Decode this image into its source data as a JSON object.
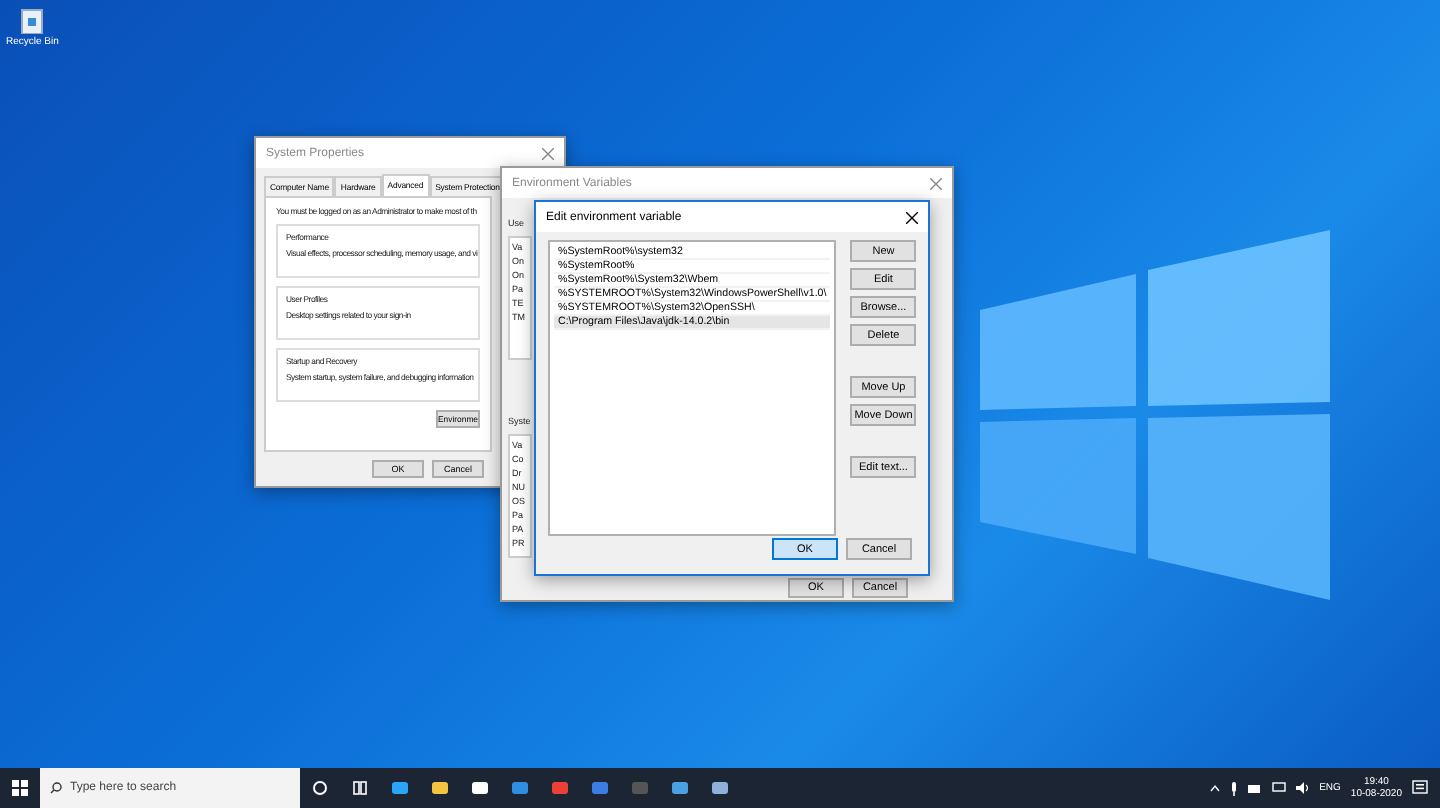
{
  "desktop_icons": [
    {
      "label": "Recycle Bin"
    }
  ],
  "system_properties": {
    "title": "System Properties",
    "tabs": [
      {
        "label": "Computer Name",
        "selected": false
      },
      {
        "label": "Hardware",
        "selected": false
      },
      {
        "label": "Advanced",
        "selected": true
      },
      {
        "label": "System Protection",
        "selected": false
      }
    ],
    "notice": "You must be logged on as an Administrator to make most of th",
    "groups": [
      {
        "title": "Performance",
        "description": "Visual effects, processor scheduling, memory usage, and vi"
      },
      {
        "title": "User Profiles",
        "description": "Desktop settings related to your sign-in"
      },
      {
        "title": "Startup and Recovery",
        "description": "System startup, system failure, and debugging information"
      }
    ],
    "environment_button": "Environme",
    "buttons": [
      "OK",
      "Cancel"
    ]
  },
  "environment_variables": {
    "title": "Environment Variables",
    "user_label": "Use",
    "user_rows": [
      "Va",
      "On",
      "On",
      "Pa",
      "TE",
      "TM"
    ],
    "system_label": "Syste",
    "system_rows": [
      "Va",
      "Co",
      "Dr",
      "NU",
      "OS",
      "Pa",
      "PA",
      "PR"
    ],
    "buttons": [
      "OK",
      "Cancel"
    ]
  },
  "edit_dialog": {
    "title": "Edit environment variable",
    "entries": [
      {
        "text": "%SystemRoot%\\system32",
        "selected": false
      },
      {
        "text": "%SystemRoot%",
        "selected": false
      },
      {
        "text": "%SystemRoot%\\System32\\Wbem",
        "selected": false
      },
      {
        "text": "%SYSTEMROOT%\\System32\\WindowsPowerShell\\v1.0\\",
        "selected": false
      },
      {
        "text": "%SYSTEMROOT%\\System32\\OpenSSH\\",
        "selected": false
      },
      {
        "text": "C:\\Program Files\\Java\\jdk-14.0.2\\bin",
        "selected": true
      }
    ],
    "side_buttons": [
      "New",
      "Edit",
      "Browse...",
      "Delete",
      "Move Up",
      "Move Down",
      "Edit text..."
    ],
    "buttons": [
      {
        "label": "OK",
        "focused": true
      },
      {
        "label": "Cancel",
        "focused": false
      }
    ]
  },
  "taskbar": {
    "search_placeholder": "Type here to search",
    "language": "ENG",
    "time": "19:40",
    "date": "10-08-2020"
  }
}
